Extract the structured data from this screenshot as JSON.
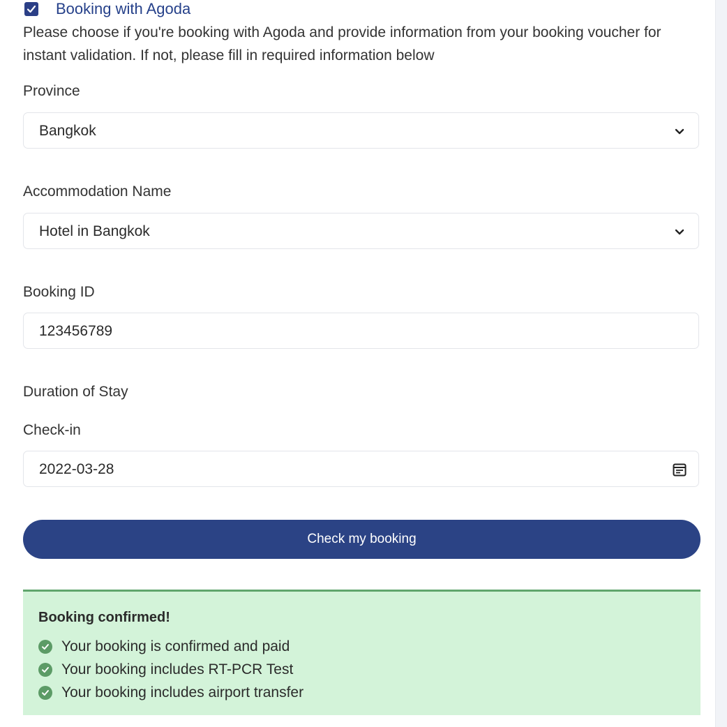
{
  "booking_toggle": {
    "label": "Booking with Agoda",
    "checked": true
  },
  "description": "Please choose if you're booking with Agoda and provide information from your booking voucher for instant validation. If not, please fill in required information below",
  "province": {
    "label": "Province",
    "value": "Bangkok"
  },
  "accommodation": {
    "label": "Accommodation Name",
    "value": "Hotel in Bangkok"
  },
  "booking_id": {
    "label": "Booking ID",
    "value": "123456789"
  },
  "duration": {
    "label": "Duration of Stay",
    "checkin_label": "Check-in",
    "checkin_value": "2022-03-28"
  },
  "check_button": {
    "label": "Check my booking"
  },
  "result": {
    "title": "Booking confirmed!",
    "items": [
      "Your booking is confirmed and paid",
      "Your booking includes RT-PCR Test",
      "Your booking includes airport transfer"
    ]
  },
  "colors": {
    "brand": "#2b4385",
    "success_bg": "#d3f3d9",
    "success_border": "#5fa56c",
    "check_icon": "#5c9b66"
  },
  "icons": {
    "select": "chevron-down-icon",
    "date": "calendar-icon",
    "status": "check-circle-icon"
  }
}
